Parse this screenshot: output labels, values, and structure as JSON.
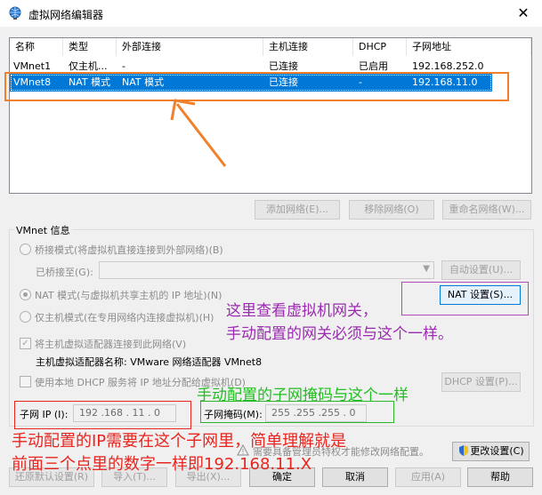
{
  "window": {
    "title": "虚拟网络编辑器",
    "close_glyph": "✕"
  },
  "table": {
    "headers": [
      "名称",
      "类型",
      "外部连接",
      "主机连接",
      "DHCP",
      "子网地址"
    ],
    "rows": [
      [
        "VMnet1",
        "仅主机...",
        "-",
        "已连接",
        "已启用",
        "192.168.252.0"
      ],
      [
        "VMnet8",
        "NAT 模式",
        "NAT 模式",
        "已连接",
        "-",
        "192.168.11.0"
      ]
    ],
    "selected_index": 1
  },
  "list_buttons": {
    "add": "添加网络(E)...",
    "remove": "移除网络(O)",
    "rename": "重命名网络(W)..."
  },
  "vmnet_info": {
    "title": "VMnet 信息",
    "bridge_mode": "桥接模式(将虚拟机直接连接到外部网络)(B)",
    "bridged_to_label": "已桥接至(G):",
    "auto_settings": "自动设置(U)...",
    "nat_mode": "NAT 模式(与虚拟机共享主机的 IP 地址)(N)",
    "nat_settings": "NAT 设置(S)...",
    "host_only": "仅主机模式(在专用网络内连接虚拟机)(H)",
    "connect_adapter": "将主机虚拟适配器连接到此网络(V)",
    "adapter_name": "主机虚拟适配器名称: VMware 网络适配器 VMnet8",
    "use_dhcp": "使用本地 DHCP 服务将 IP 地址分配给虚拟机(D)",
    "dhcp_settings": "DHCP 设置(P)...",
    "subnet_ip_label": "子网 IP (I):",
    "subnet_ip_value": "192 .168 . 11 .  0",
    "subnet_mask_label": "子网掩码(M):",
    "subnet_mask_value": "255 .255 .255 .  0",
    "radio_selected": "nat",
    "connect_adapter_checked": true,
    "use_dhcp_checked": false
  },
  "footer": {
    "admin_note": "需要具备管理员特权才能修改网络配置。",
    "change_settings": "更改设置(C)",
    "restore_defaults": "还原默认设置(R)",
    "import": "导入(T)...",
    "export": "导出(X)...",
    "ok": "确定",
    "cancel": "取消",
    "apply": "应用(A)",
    "help": "帮助"
  },
  "annotations": {
    "gateway_note": [
      "这里查看虚拟机网关，",
      "手动配置的网关必须与这个一样。"
    ],
    "mask_note": "手动配置的子网掩码与这个一样",
    "ip_note": [
      "手动配置的IP需要在这个子网里，简单理解就是",
      "前面三个点里的数字一样即192.168.11.X"
    ],
    "colors": {
      "red": "#e8251e",
      "green": "#2bb52b",
      "purple": "#b04ab8",
      "orange": "#f0802a",
      "selection": "#0078d7"
    }
  }
}
